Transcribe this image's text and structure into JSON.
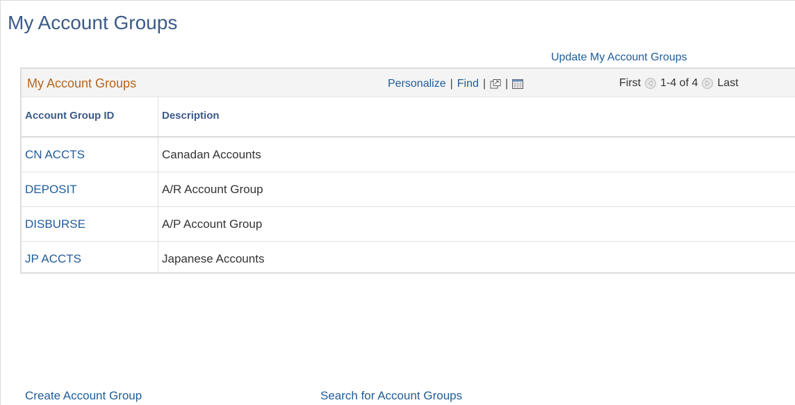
{
  "page": {
    "title": "My Account Groups",
    "update_link": "Update My Account Groups"
  },
  "grid": {
    "title": "My Account Groups",
    "tools": {
      "personalize": "Personalize",
      "find": "Find",
      "separator": "|",
      "view_all_icon": "new-window-icon",
      "download_icon": "spreadsheet-icon"
    },
    "nav": {
      "first": "First",
      "range": "1-4 of 4",
      "last": "Last",
      "prev_icon": "left-arrow-circle-icon",
      "next_icon": "right-arrow-circle-icon"
    },
    "columns": [
      "Account Group ID",
      "Description"
    ],
    "rows": [
      {
        "id": "CN ACCTS",
        "description": "Canadan Accounts"
      },
      {
        "id": "DEPOSIT",
        "description": "A/R Account Group"
      },
      {
        "id": "DISBURSE",
        "description": "A/P Account Group"
      },
      {
        "id": "JP ACCTS",
        "description": "Japanese Accounts"
      }
    ]
  },
  "footer": {
    "create_link": "Create Account Group",
    "search_link": "Search for Account Groups"
  },
  "colors": {
    "title": "#3b5a87",
    "link": "#1f5c99",
    "grid_title": "#b5651d"
  }
}
